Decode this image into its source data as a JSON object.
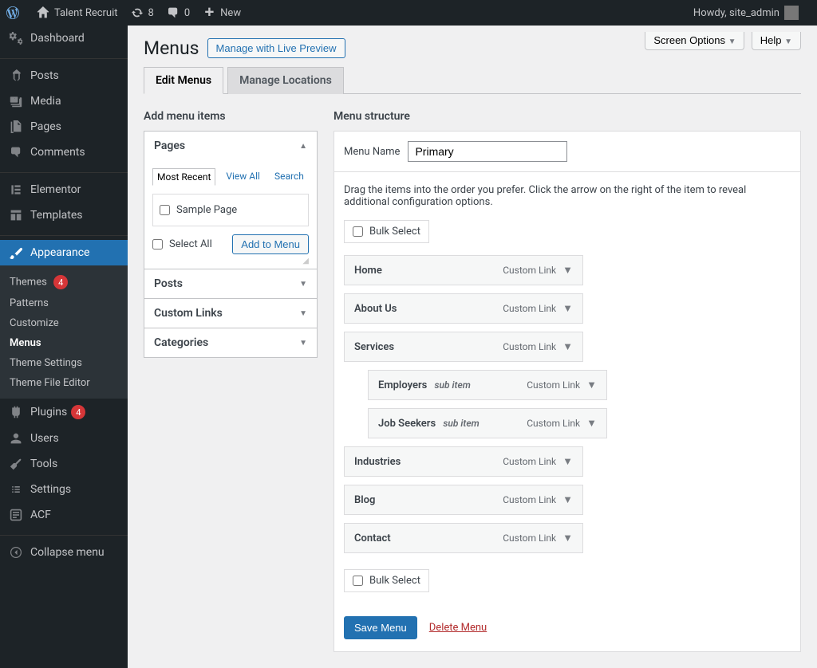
{
  "topbar": {
    "site_name": "Talent Recruit",
    "updates": "8",
    "comments": "0",
    "new": "New",
    "howdy": "Howdy, site_admin"
  },
  "sidebar": {
    "dashboard": "Dashboard",
    "posts": "Posts",
    "media": "Media",
    "pages": "Pages",
    "comments": "Comments",
    "elementor": "Elementor",
    "templates": "Templates",
    "appearance": "Appearance",
    "plugins": "Plugins",
    "plugins_badge": "4",
    "users": "Users",
    "tools": "Tools",
    "settings": "Settings",
    "acf": "ACF",
    "collapse": "Collapse menu",
    "sub": {
      "themes": "Themes",
      "themes_badge": "4",
      "patterns": "Patterns",
      "customize": "Customize",
      "menus": "Menus",
      "theme_settings": "Theme Settings",
      "theme_editor": "Theme File Editor"
    }
  },
  "screen": {
    "options": "Screen Options",
    "help": "Help"
  },
  "page": {
    "title": "Menus",
    "live_preview": "Manage with Live Preview",
    "tab_edit": "Edit Menus",
    "tab_locations": "Manage Locations",
    "add_heading": "Add menu items",
    "structure_heading": "Menu structure"
  },
  "addmenu": {
    "pages": "Pages",
    "posts": "Posts",
    "custom": "Custom Links",
    "categories": "Categories",
    "recent": "Most Recent",
    "view_all": "View All",
    "search": "Search",
    "sample": "Sample Page",
    "select_all": "Select All",
    "add_btn": "Add to Menu"
  },
  "structure": {
    "name_label": "Menu Name",
    "name_value": "Primary",
    "help": "Drag the items into the order you prefer. Click the arrow on the right of the item to reveal additional configuration options.",
    "bulk": "Bulk Select",
    "sub_label": "sub item",
    "type_custom": "Custom Link",
    "items": {
      "home": "Home",
      "about": "About Us",
      "services": "Services",
      "employers": "Employers",
      "jobseekers": "Job Seekers",
      "industries": "Industries",
      "blog": "Blog",
      "contact": "Contact"
    },
    "save": "Save Menu",
    "delete": "Delete Menu"
  }
}
